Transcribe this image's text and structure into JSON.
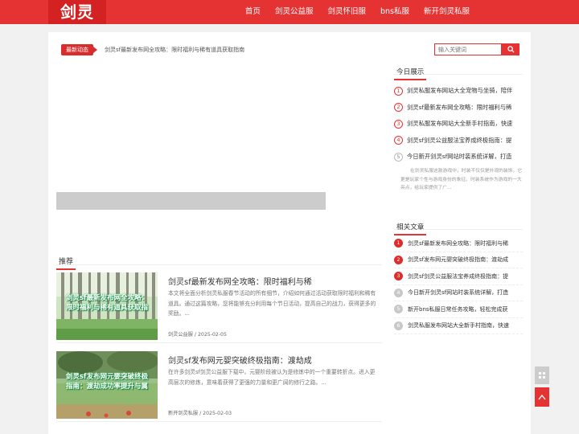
{
  "site": {
    "logo": "剑灵",
    "nav": [
      "首页",
      "剑灵公益服",
      "剑灵怀旧服",
      "bns私服",
      "新开剑灵私服"
    ]
  },
  "ticker": {
    "tag": "最新动态",
    "text": "剑灵sf最新发布网全攻略：限时福利与稀有道具获取指南"
  },
  "search": {
    "placeholder": "输入关键词"
  },
  "recommend": {
    "heading": "推荐",
    "articles": [
      {
        "thumb_caption": "剑灵sf最新发布网全攻略：限时福利与稀有道具获取指",
        "title": "剑灵sf最新发布网全攻略：限时福利与稀",
        "desc": "本文将全面分析剑灵私服春节活动的所有细节，介绍如何通过活动获取限时福利和稀有道具。通过这篇攻略，您将能够充分利用每个节日活动，提高自己的战力，获得更多的奖励。...",
        "category": "剑灵公益服",
        "date": "2025-02-05"
      },
      {
        "thumb_caption": "剑灵sf发布网元婴突破终极指南：渡劫成功率提升与属",
        "title": "剑灵sf发布网元婴突破终极指南：渡劫成",
        "desc": "在许多剑灵sf剑灵公益服下载中，元婴阶段被认为是修炼中的一个重要转折点。进入更高层次的修炼，意味着获得了更强的力量和更广阔的修行之路。...",
        "category": "新开剑灵私服",
        "date": "2025-02-03"
      }
    ]
  },
  "today": {
    "heading": "今日展示",
    "items": [
      "剑灵私服发布网站大全宠物与坐骑，陪伴",
      "剑灵sf最新发布网全攻略：限时福利与稀",
      "剑灵私服发布网站大全新手村指南，快速",
      "剑灵sf剑灵公益服法宝养成终极指南：提",
      "今日新开剑灵sf网站时装系统详解，打造"
    ],
    "desc": "在剑灵私服这款游戏中，时装不仅仅是外观的装饰，它更是玩家个性与游戏身份的象征。时装系统作为游戏的一大亮点，给玩家提供了广..."
  },
  "related": {
    "heading": "相关文章",
    "items": [
      "剑灵sf最新发布网全攻略：限时福利与稀",
      "剑灵sf发布网元婴突破终极指南：渡劫成",
      "剑灵sf剑灵公益服法宝养成终极指南：提",
      "今日新开剑灵sf网站时装系统详解，打造",
      "新开bns私服日常任务攻略，轻松完成获",
      "剑灵私服发布网站大全新手村指南，快速"
    ]
  }
}
